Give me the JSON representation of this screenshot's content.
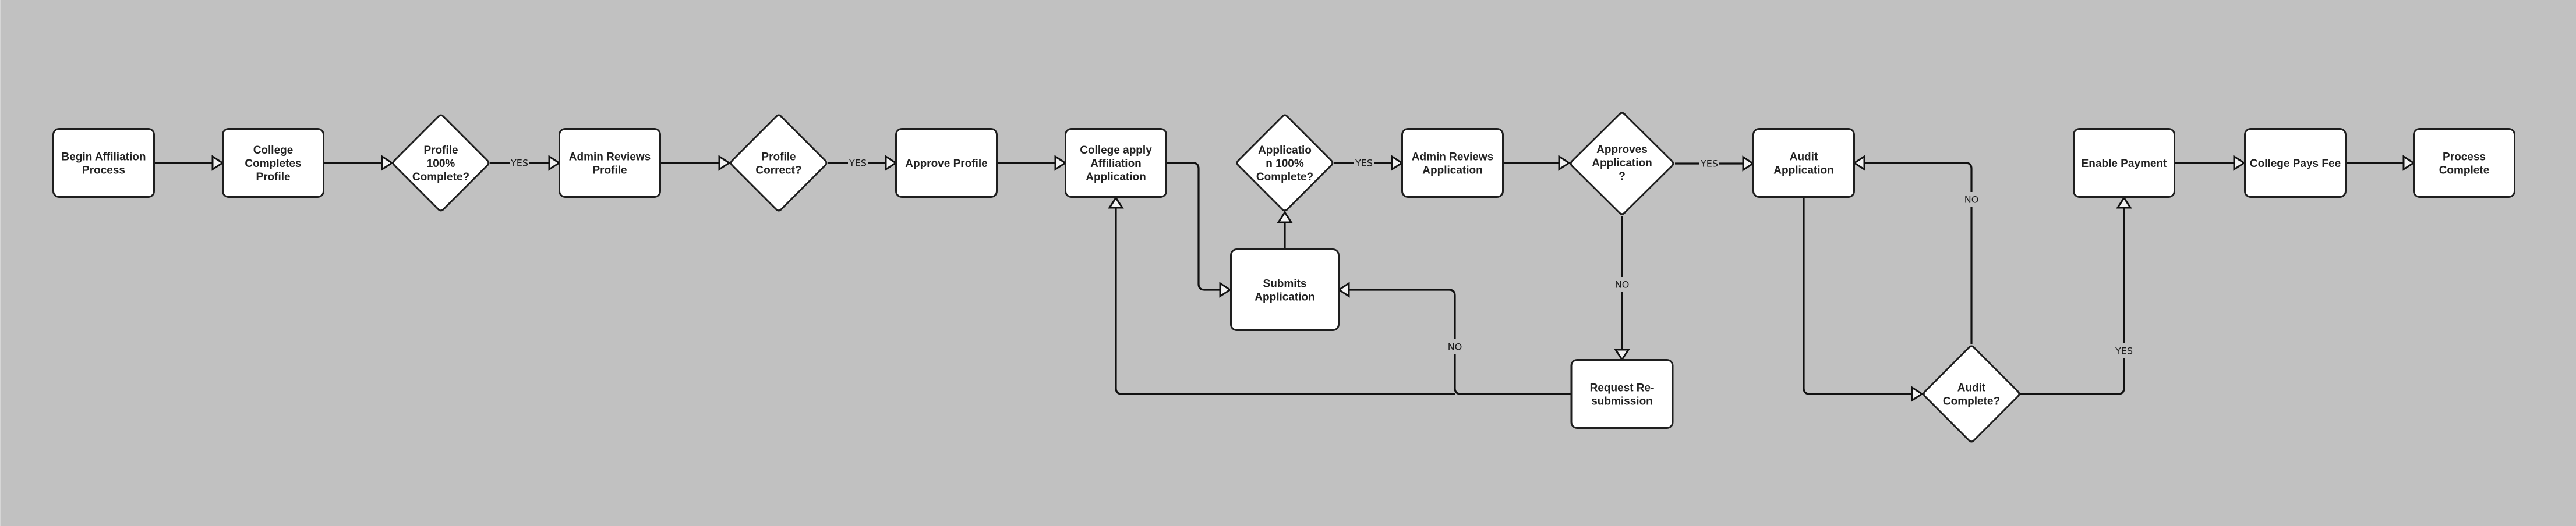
{
  "diagram": {
    "type": "flowchart",
    "background_color": "#c1c1c1",
    "node_fill": "#ffffff",
    "line_color": "#111111",
    "nodes": [
      {
        "id": "begin",
        "shape": "process",
        "lines": [
          "Begin Affiliation",
          "Process"
        ]
      },
      {
        "id": "college-completes-profile",
        "shape": "process",
        "lines": [
          "College",
          "Completes",
          "Profile"
        ]
      },
      {
        "id": "profile-complete-decision",
        "shape": "decision",
        "lines": [
          "Profile",
          "100%",
          "Complete?"
        ]
      },
      {
        "id": "admin-reviews-profile",
        "shape": "process",
        "lines": [
          "Admin Reviews",
          "Profile"
        ]
      },
      {
        "id": "profile-correct-decision",
        "shape": "decision",
        "lines": [
          "Profile",
          "Correct?"
        ]
      },
      {
        "id": "approve-profile",
        "shape": "process",
        "lines": [
          "Approve Profile"
        ]
      },
      {
        "id": "college-apply",
        "shape": "process",
        "lines": [
          "College apply",
          "Affiliation",
          "Application"
        ]
      },
      {
        "id": "application-complete-decision",
        "shape": "decision",
        "lines": [
          "Applicatio",
          "n 100%",
          "Complete?"
        ]
      },
      {
        "id": "admin-reviews-application",
        "shape": "process",
        "lines": [
          "Admin Reviews",
          "Application"
        ]
      },
      {
        "id": "approves-application-decision",
        "shape": "decision",
        "lines": [
          "Approves",
          "Application",
          "?"
        ]
      },
      {
        "id": "audit-application",
        "shape": "process",
        "lines": [
          "Audit",
          "Application"
        ]
      },
      {
        "id": "enable-payment",
        "shape": "process",
        "lines": [
          "Enable Payment"
        ]
      },
      {
        "id": "college-pays-fee",
        "shape": "process",
        "lines": [
          "College Pays Fee"
        ]
      },
      {
        "id": "process-complete",
        "shape": "process",
        "lines": [
          "Process",
          "Complete"
        ]
      },
      {
        "id": "submits-application",
        "shape": "process",
        "lines": [
          "Submits",
          "Application"
        ]
      },
      {
        "id": "request-resubmission",
        "shape": "process",
        "lines": [
          "Request Re-",
          "submission"
        ]
      },
      {
        "id": "audit-complete-decision",
        "shape": "decision",
        "lines": [
          "Audit",
          "Complete?"
        ]
      }
    ],
    "edges": [
      {
        "from": "begin",
        "to": "college-completes-profile",
        "label": ""
      },
      {
        "from": "college-completes-profile",
        "to": "profile-complete-decision",
        "label": ""
      },
      {
        "from": "profile-complete-decision",
        "to": "admin-reviews-profile",
        "label": "YES"
      },
      {
        "from": "admin-reviews-profile",
        "to": "profile-correct-decision",
        "label": ""
      },
      {
        "from": "profile-correct-decision",
        "to": "approve-profile",
        "label": "YES"
      },
      {
        "from": "approve-profile",
        "to": "college-apply",
        "label": ""
      },
      {
        "from": "college-apply",
        "to": "submits-application",
        "label": ""
      },
      {
        "from": "submits-application",
        "to": "application-complete-decision",
        "label": ""
      },
      {
        "from": "application-complete-decision",
        "to": "admin-reviews-application",
        "label": "YES"
      },
      {
        "from": "admin-reviews-application",
        "to": "approves-application-decision",
        "label": ""
      },
      {
        "from": "approves-application-decision",
        "to": "audit-application",
        "label": "YES"
      },
      {
        "from": "approves-application-decision",
        "to": "request-resubmission",
        "label": "NO"
      },
      {
        "from": "request-resubmission",
        "to": "submits-application",
        "label": "NO"
      },
      {
        "from": "request-resubmission",
        "to": "college-apply",
        "label": ""
      },
      {
        "from": "audit-application",
        "to": "audit-complete-decision",
        "label": ""
      },
      {
        "from": "audit-complete-decision",
        "to": "audit-application",
        "label": "NO"
      },
      {
        "from": "audit-complete-decision",
        "to": "enable-payment",
        "label": "YES"
      },
      {
        "from": "enable-payment",
        "to": "college-pays-fee",
        "label": ""
      },
      {
        "from": "college-pays-fee",
        "to": "process-complete",
        "label": ""
      }
    ]
  }
}
